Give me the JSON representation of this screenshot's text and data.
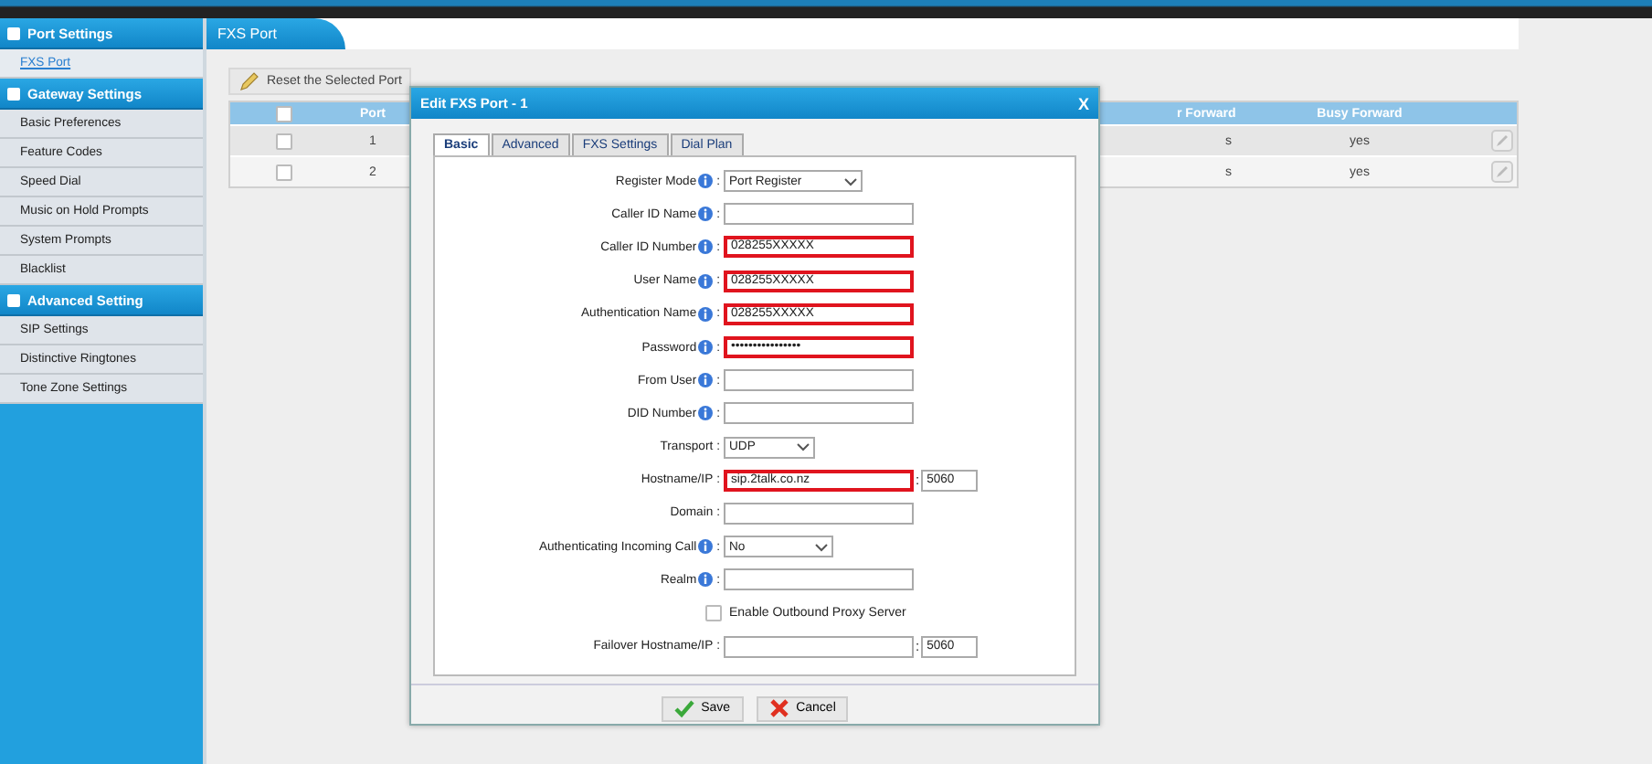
{
  "sidebar": {
    "sections": [
      {
        "title": "Port Settings",
        "items": [
          {
            "label": "FXS Port",
            "selected": true
          }
        ]
      },
      {
        "title": "Gateway Settings",
        "items": [
          {
            "label": "Basic Preferences",
            "selected": false
          },
          {
            "label": "Feature Codes",
            "selected": false
          },
          {
            "label": "Speed Dial",
            "selected": false
          },
          {
            "label": "Music on Hold Prompts",
            "selected": false
          },
          {
            "label": "System Prompts",
            "selected": false
          },
          {
            "label": "Blacklist",
            "selected": false
          }
        ]
      },
      {
        "title": "Advanced Setting",
        "items": [
          {
            "label": "SIP Settings",
            "selected": false
          },
          {
            "label": "Distinctive Ringtones",
            "selected": false
          },
          {
            "label": "Tone Zone Settings",
            "selected": false
          }
        ]
      }
    ]
  },
  "page_title": "FXS Port",
  "reset_button": "Reset the Selected Port",
  "table": {
    "all_checked": false,
    "columns": [
      "Port",
      "r Forward",
      "Busy Forward"
    ],
    "rows": [
      {
        "checked": false,
        "cells": [
          "1",
          "s",
          "yes"
        ]
      },
      {
        "checked": false,
        "cells": [
          "2",
          "s",
          "yes"
        ]
      }
    ]
  },
  "dialog": {
    "title": "Edit FXS Port - 1",
    "close": "X",
    "tabs": [
      {
        "label": "Basic",
        "selected": true
      },
      {
        "label": "Advanced",
        "selected": false
      },
      {
        "label": "FXS Settings",
        "selected": false
      },
      {
        "label": "Dial Plan",
        "selected": false
      }
    ],
    "fields": [
      {
        "kind": "select",
        "label": "Register Mode",
        "info": true,
        "colon": ":",
        "value": "Port Register",
        "highlighted": false
      },
      {
        "kind": "text",
        "label": "Caller ID Name",
        "info": true,
        "colon": ":",
        "highlighted": false
      },
      {
        "kind": "text",
        "label": "Caller ID Number",
        "info": true,
        "colon": ":",
        "value": "028255XXXXX",
        "highlighted": true
      },
      {
        "kind": "text",
        "label": "User Name",
        "info": true,
        "colon": ":",
        "value": "028255XXXXX",
        "highlighted": true
      },
      {
        "kind": "text",
        "label": "Authentication Name",
        "info": true,
        "colon": ":",
        "value": "028255XXXXX",
        "highlighted": true
      },
      {
        "kind": "text",
        "label": "Password",
        "info": true,
        "colon": ":",
        "value": "••••••••••••••••",
        "highlighted": true
      },
      {
        "kind": "text",
        "label": "From User",
        "info": true,
        "colon": ":",
        "highlighted": false
      },
      {
        "kind": "text",
        "label": "DID Number",
        "info": true,
        "colon": ":",
        "highlighted": false
      },
      {
        "kind": "select",
        "label": "Transport",
        "info": false,
        "colon": ":",
        "value": "UDP",
        "highlighted": false
      },
      {
        "kind": "text",
        "label": "Hostname/IP",
        "info": false,
        "colon": ":",
        "value": "sip.2talk.co.nz",
        "highlighted": true,
        "port_colon": ":",
        "port": "5060"
      },
      {
        "kind": "text",
        "label": "Domain",
        "info": false,
        "colon": ":",
        "highlighted": false
      },
      {
        "kind": "select",
        "label": "Authenticating Incoming Call",
        "info": true,
        "colon": ":",
        "value": "No",
        "highlighted": false
      },
      {
        "kind": "text",
        "label": "Realm",
        "info": true,
        "colon": ":",
        "highlighted": false
      },
      {
        "kind": "checkbox",
        "label": "Enable Outbound Proxy Server",
        "checked": false
      },
      {
        "kind": "text",
        "label": "Failover Hostname/IP",
        "info": false,
        "colon": ":",
        "highlighted": false,
        "port_colon": ":",
        "port": "5060"
      }
    ],
    "buttons": [
      {
        "kind": "save",
        "label": "Save"
      },
      {
        "kind": "cancel",
        "label": "Cancel"
      }
    ]
  }
}
